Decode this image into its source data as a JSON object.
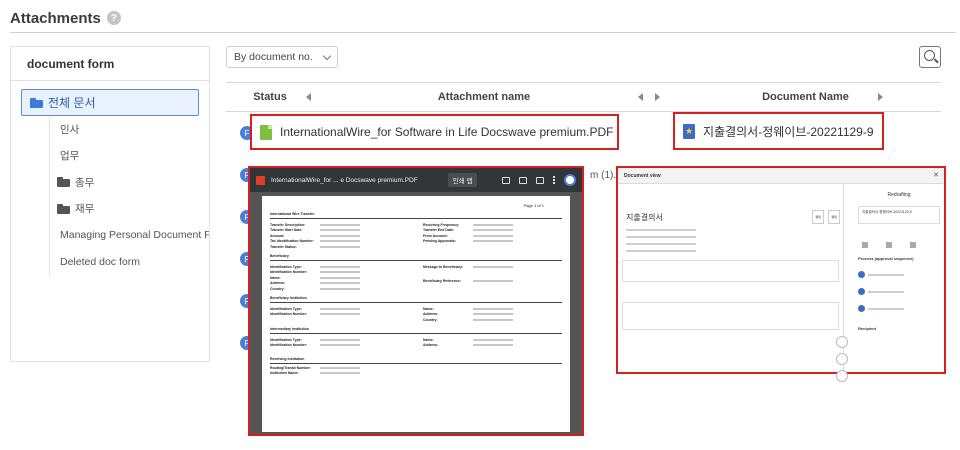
{
  "header": {
    "title": "Attachments",
    "help_glyph": "?"
  },
  "sidebar": {
    "title": "document form",
    "root_label": "전체 문서",
    "items": [
      {
        "label": "인사",
        "type": "leaf"
      },
      {
        "label": "업무",
        "type": "leaf"
      },
      {
        "label": "총무",
        "type": "folder"
      },
      {
        "label": "재무",
        "type": "folder"
      },
      {
        "label": "Managing Personal Document F...",
        "type": "leaf"
      },
      {
        "label": "Deleted doc form",
        "type": "leaf"
      }
    ]
  },
  "toolbar": {
    "filter_value": "By document no."
  },
  "table": {
    "headers": {
      "status": "Status",
      "attachment": "Attachment name",
      "document": "Document Name"
    },
    "status_glyph": "F",
    "partial_text": "m (1).F"
  },
  "highlight": {
    "attachment_name": "InternationalWire_for Software in Life Docswave premium.PDF",
    "document_name": "지출결의서-정웨이브-20221129-9"
  },
  "pdf_viewer": {
    "filename": "InternationalWire_for ... e Docswave premium.PDF",
    "toolbar_pill": "인쇄 맵",
    "page_label": "Page 1 of 1",
    "sections": [
      {
        "title": "International Wire Transfer",
        "left": [
          "Transfer Description:",
          "Transfer Start Date:",
          "Amount:",
          "Tax Identification Number:",
          "Transfer Status:"
        ],
        "right": [
          "Recurring Frequency:",
          "Transfer End Date:",
          "From Account:",
          "Pending Approvals:"
        ]
      },
      {
        "title": "Beneficiary",
        "left": [
          "Identification Type:",
          "Identification Number:",
          "Name:",
          "Address:"
        ],
        "right": [
          "Message to Beneficiary:",
          "Beneficiary Reference:"
        ]
      },
      {
        "title": "Beneficiary Institution",
        "left": [
          "Identification Type:",
          "Identification Number:"
        ],
        "right": [
          "Name:",
          "Address:",
          "Country:"
        ]
      },
      {
        "title": "Intermediary Institution",
        "left": [
          "Identification Type:",
          "Identification Number:"
        ],
        "right": [
          "Name:",
          "Address:"
        ]
      },
      {
        "title": "Receiving Institution",
        "left": [
          "Routing/Transit Number:",
          "Institution Name:"
        ],
        "right": []
      }
    ],
    "country_label": "Country:"
  },
  "doc_view": {
    "title": "Document view",
    "doc_heading": "지출결의서",
    "side_title": "Redrafting",
    "side_doc": "지출결의서-정웨이브-20221129-9",
    "process_label": "Process (approval sequence)",
    "recipient_label": "Recipient",
    "stamps": [
      "결재",
      "결재"
    ]
  }
}
